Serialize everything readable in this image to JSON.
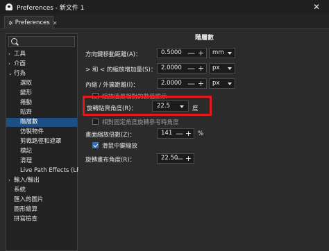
{
  "window": {
    "title": "Preferences - 新文件 1",
    "close_glyph": "✕"
  },
  "tab": {
    "label": "Preferences",
    "close_glyph": "✕"
  },
  "search": {
    "placeholder": ""
  },
  "tree": [
    {
      "label": "工具",
      "arrow": "›",
      "level": 0
    },
    {
      "label": "介面",
      "arrow": "›",
      "level": 0
    },
    {
      "label": "行為",
      "arrow": "⌄",
      "level": 0
    },
    {
      "label": "選取",
      "arrow": "",
      "level": 1
    },
    {
      "label": "變形",
      "arrow": "",
      "level": 1
    },
    {
      "label": "捲動",
      "arrow": "",
      "level": 1
    },
    {
      "label": "貼齊",
      "arrow": "",
      "level": 1
    },
    {
      "label": "階層數",
      "arrow": "",
      "level": 1,
      "selected": true
    },
    {
      "label": "仿製物件",
      "arrow": "",
      "level": 1
    },
    {
      "label": "剪裁路徑和遮罩",
      "arrow": "",
      "level": 1
    },
    {
      "label": "標記",
      "arrow": "",
      "level": 1
    },
    {
      "label": "清理",
      "arrow": "",
      "level": 1
    },
    {
      "label": "Live Path Effects (LPE)",
      "arrow": "",
      "level": 1
    },
    {
      "label": "輸入/輸出",
      "arrow": "›",
      "level": 0
    },
    {
      "label": "系統",
      "arrow": "",
      "level": 0
    },
    {
      "label": "匯入的圖片",
      "arrow": "",
      "level": 0
    },
    {
      "label": "圖形繪算",
      "arrow": "",
      "level": 0
    },
    {
      "label": "拼寫檢查",
      "arrow": "",
      "level": 0
    }
  ],
  "page": {
    "title": "階層數",
    "arrow_keys": {
      "label": "方向鍵移動距離(A)：",
      "value": "0.5000",
      "unit": "mm"
    },
    "scale_step": {
      "label": "> 和 < 的縮放增加量(S)：",
      "value": "2.0000",
      "unit": "px"
    },
    "inset_outset": {
      "label": "內縮 / 外擴距離(I)：",
      "value": "2.0000",
      "unit": "px"
    },
    "compass_relative": {
      "label": "縮放值是相對的數值顯示",
      "checked": false
    },
    "rotation_snap": {
      "label": "旋轉貼齊角度(R)：",
      "value": "22.5",
      "unit": "度"
    },
    "relative_rotation": {
      "label": "相對固定角度旋轉參考時角度",
      "checked": false
    },
    "zoom_factor": {
      "label": "畫面縮放倍數(Z)：",
      "value": "141",
      "unit": "%"
    },
    "middle_zoom": {
      "label": "滑鼠中鍵縮放",
      "checked": true
    },
    "canvas_rotation": {
      "label": "旋轉畫布角度(R)：",
      "value": "22.50"
    }
  },
  "glyphs": {
    "minus": "—",
    "plus": "+"
  },
  "colors": {
    "selection": "#1e4e86",
    "highlight": "#e3191c",
    "checkbox_checked": "#2f6fc4"
  }
}
